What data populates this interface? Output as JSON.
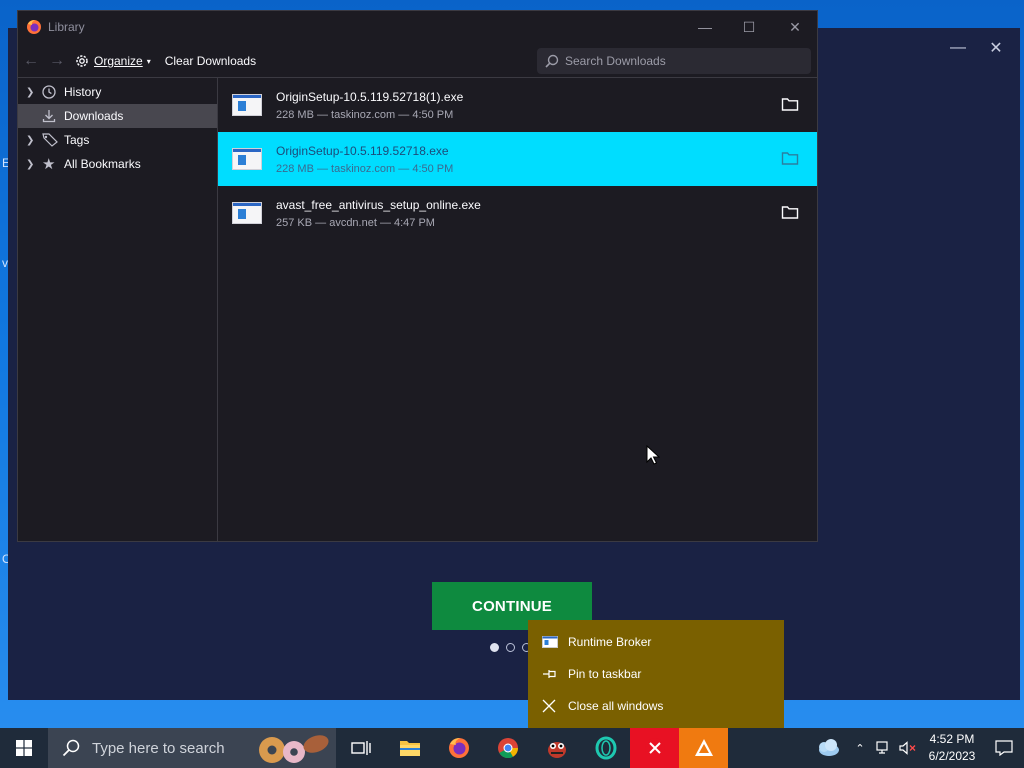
{
  "library": {
    "title": "Library",
    "toolbar": {
      "organize_label": "Organize",
      "clear_label": "Clear Downloads",
      "search_placeholder": "Search Downloads"
    },
    "sidebar": [
      {
        "label": "History",
        "icon": "clock-icon",
        "expandable": true
      },
      {
        "label": "Downloads",
        "icon": "download-icon",
        "expandable": false,
        "selected": true
      },
      {
        "label": "Tags",
        "icon": "tag-icon",
        "expandable": true
      },
      {
        "label": "All Bookmarks",
        "icon": "star-icon",
        "expandable": true
      }
    ],
    "downloads": [
      {
        "name": "OriginSetup-10.5.119.52718(1).exe",
        "meta": "228 MB — taskinoz.com — 4:50 PM"
      },
      {
        "name": "OriginSetup-10.5.119.52718.exe",
        "meta": "228 MB — taskinoz.com — 4:50 PM",
        "selected": true
      },
      {
        "name": "avast_free_antivirus_setup_online.exe",
        "meta": "257 KB — avcdn.net — 4:47 PM"
      }
    ]
  },
  "installer": {
    "continue_label": "CONTINUE",
    "page_dots": 3,
    "active_dot": 1
  },
  "jumplist": {
    "items": [
      {
        "label": "Runtime Broker",
        "icon": "app-window-icon"
      },
      {
        "label": "Pin to taskbar",
        "icon": "pin-icon"
      },
      {
        "label": "Close all windows",
        "icon": "close-icon"
      }
    ]
  },
  "taskbar": {
    "search_placeholder": "Type here to search",
    "time": "4:52 PM",
    "date": "6/2/2023"
  },
  "colors": {
    "selected_row": "#00ddff",
    "jumplist_bg": "#7a6000",
    "continue_bg": "#0e8a3f"
  }
}
